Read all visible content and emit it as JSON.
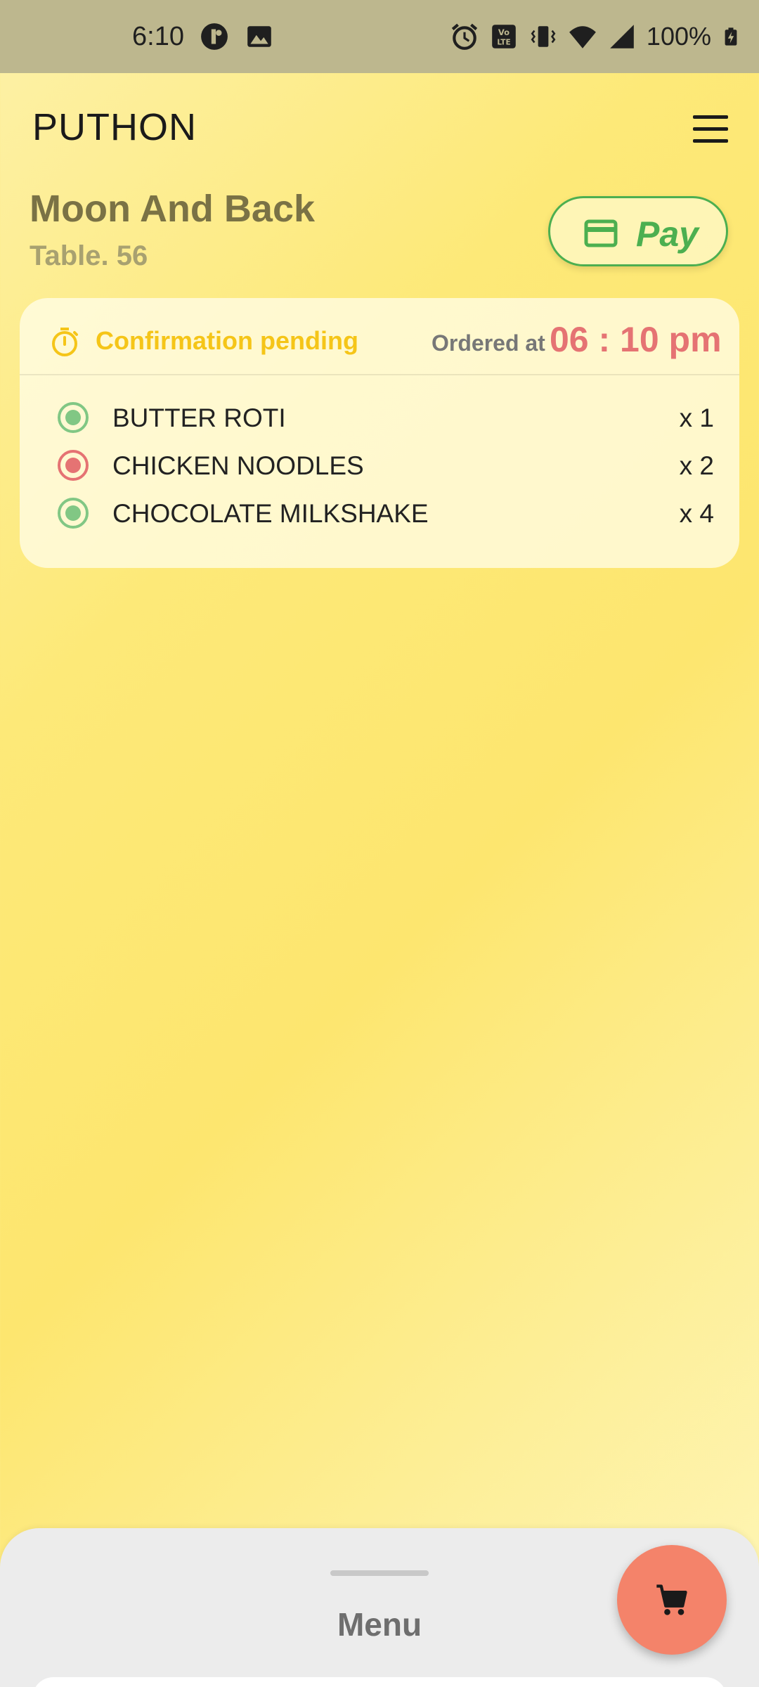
{
  "status_bar": {
    "time": "6:10",
    "battery": "100%",
    "icons": [
      "threads-icon",
      "image-icon",
      "alarm-icon",
      "volte-icon",
      "vibrate-icon",
      "wifi-icon",
      "signal-icon",
      "battery-charging-icon"
    ]
  },
  "header": {
    "app_title": "PUTHON",
    "menu_icon": "hamburger-menu-icon"
  },
  "restaurant": {
    "name": "Moon And Back",
    "table": "Table. 56"
  },
  "pay_button": {
    "label": "Pay",
    "icon": "credit-card-icon",
    "color": "#4caf50"
  },
  "order": {
    "status": "Confirmation pending",
    "status_icon": "stopwatch-icon",
    "status_color": "#f5c518",
    "ordered_at_label": "Ordered at",
    "ordered_at_time": "06 : 10 pm",
    "time_color": "#e57373",
    "items": [
      {
        "name": "BUTTER ROTI",
        "qty": "x 1",
        "type": "veg",
        "color": "#81c784"
      },
      {
        "name": "CHICKEN NOODLES",
        "qty": "x 2",
        "type": "non-veg",
        "color": "#e57373"
      },
      {
        "name": "CHOCOLATE MILKSHAKE",
        "qty": "x 4",
        "type": "veg",
        "color": "#81c784"
      }
    ]
  },
  "bottom_sheet": {
    "title": "Menu"
  },
  "cart_fab": {
    "icon": "cart-icon",
    "color": "#f4836a"
  }
}
